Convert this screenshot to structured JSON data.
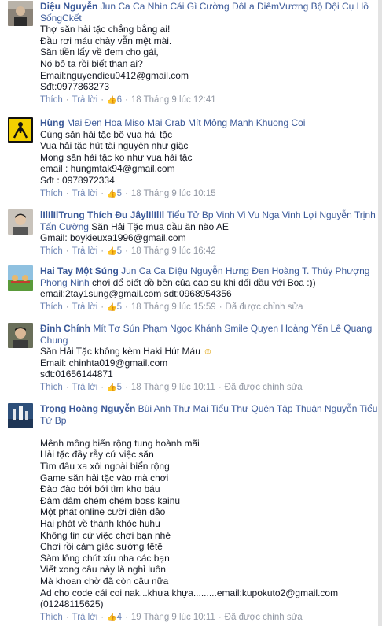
{
  "comments": [
    {
      "name": "Diệu Nguyễn",
      "tags_line1": " Jun Ca Ca Nhìn Cái Gì Cường ĐôLa DiêmVương Bộ Đội Cụ Hồ",
      "tags_line2": "SốngCkết",
      "lines": [
        "Thợ săn hải tặc chẳng bằng ai!",
        "Đầu rơi máu chảy vẫn mệt mài.",
        "Săn tiền lấy về đem cho gái,",
        "Nó bỏ ta rồi biết than ai?",
        "Email:nguyendieu0412@gmail.com",
        "Sđt:0977863273"
      ],
      "like": "Thích",
      "reply": "Trả lời",
      "count": "6",
      "time": "18 Tháng 9 lúc 12:41",
      "edited": ""
    },
    {
      "name": "Hùng",
      "tags_line1": " Mai Đen Hoa Miso Mai Crab Mít Mỏng Manh Khuong Coi",
      "tags_line2": "",
      "lines": [
        "Cùng săn hải tặc bô vua hải tặc",
        "Vua hải tặc hút tài nguyên như giặc",
        "Mong săn hải tặc ko như vua hải tặc",
        "email : hungmtak94@gmail.com",
        "Sđt : 0978972334"
      ],
      "like": "Thích",
      "reply": "Trả lời",
      "count": "5",
      "time": "18 Tháng 9 lúc 10:15",
      "edited": ""
    },
    {
      "name": "lIlIlIlTrung Thích Đu JâylIlIlIl",
      "tags_line1": " Tiểu Tử Bp Vinh Vi Vu Nga Vinh Lợi Nguyễn Trịnh",
      "tags_line2": "Tấn Cường",
      "tail2": " Săn Hải Tặc mua dầu ăn nào AE",
      "lines": [
        "Gmail: boykieuxa1996@gmail.com"
      ],
      "like": "Thích",
      "reply": "Trả lời",
      "count": "5",
      "time": "18 Tháng 9 lúc 16:42",
      "edited": ""
    },
    {
      "name": "Hai Tay Một Súng",
      "tags_line1": " Jun Ca Ca Diệu Nguyễn Hưng Đen Hoàng T. Thúy Phượng",
      "tags_line2": "Phong Ninh",
      "tail2": " chơi để biết đồ bền của cao su khi đối đầu với Boa :))",
      "lines": [
        "email:2tay1sung@gmail.com sdt:0968954356"
      ],
      "like": "Thích",
      "reply": "Trả lời",
      "count": "5",
      "time": "18 Tháng 9 lúc 15:59",
      "edited": "Đã được chỉnh sửa"
    },
    {
      "name": "Đinh Chính",
      "tags_line1": " Mít Tơ Sún Phạm Ngọc Khánh Smile Quyen Hoàng Yến Lê Quang",
      "tags_line2": "Chung",
      "lines": [
        "Săn Hải Tặc không kèm Haki Hút Máu",
        "Email: chinhta019@gmail.com",
        "sđt:01656144871"
      ],
      "like": "Thích",
      "reply": "Trả lời",
      "count": "5",
      "time": "18 Tháng 9 lúc 10:11",
      "edited": "Đã được chỉnh sửa"
    },
    {
      "name": "Trọng Hoàng Nguyễn",
      "tags_line1": " Bùi Anh Thư Mai Tiểu Thư Quên Tập",
      "tail1": " Thuận Nguyễn Tiểu",
      "tags_line2": "Tử Bp",
      "lines": [
        "Mênh mông biển rộng tung hoành mãi",
        "Hải tặc đầy rẫy cứ việc săn",
        "Tìm đâu xa xôi ngoài biển rộng",
        "Game săn hải tặc vào mà chơi",
        "Đào đào bới bới tìm kho báu",
        "Đâm đâm chém chém boss kainu",
        "Một phát online cười điên đảo",
        "Hai phát về thành khóc huhu",
        "Không tin cứ việc chơi bạn nhé",
        "Chơi rồi cảm giác sướng têtê",
        "Sàm lông chút xíu nha các bạn",
        "Viết xong câu này là nghỉ luôn",
        "Mà khoan chờ đã còn câu nữa",
        "Ad cho code cái coi nak...khựa khựa.........email:kupokuto2@gmail.com",
        "(01248115625)"
      ],
      "like": "Thích",
      "reply": "Trả lời",
      "count": "4",
      "time": "19 Tháng 9 lúc 10:11",
      "edited": "Đã được chỉnh sửa"
    }
  ]
}
